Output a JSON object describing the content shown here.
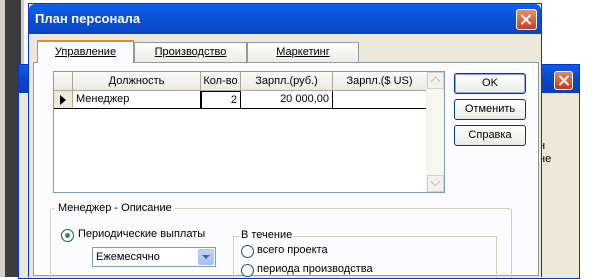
{
  "dialog": {
    "title": "План персонала",
    "tabs": [
      {
        "label": "Управление",
        "active": true
      },
      {
        "label": "Производство",
        "active": false
      },
      {
        "label": "Маркетинг",
        "active": false
      }
    ],
    "grid": {
      "columns": [
        "Должность",
        "Кол-во",
        "Зарпл.(руб.)",
        "Зарпл.($ US)"
      ],
      "rows": [
        {
          "position": "Менеджер",
          "qty": "2",
          "salary_rub": "20 000,00",
          "salary_usd": ""
        }
      ]
    },
    "buttons": {
      "ok": "OK",
      "cancel": "Отменить",
      "help": "Справка"
    },
    "description_group": {
      "label": "Менеджер - Описание",
      "periodic_label": "Периодические выплаты",
      "periodic_selected": true,
      "frequency": "Ежемесячно",
      "during_label": "В течение",
      "whole_project_label": "всего проекта",
      "production_period_label": "периода производства"
    }
  },
  "background_window": {
    "partial_text": "н\nне"
  },
  "colors": {
    "title_bar": "#0a5fe6",
    "dialog_bg": "#ece9d8",
    "tab_accent": "#e68b2c",
    "radio_dot": "#21a121"
  }
}
